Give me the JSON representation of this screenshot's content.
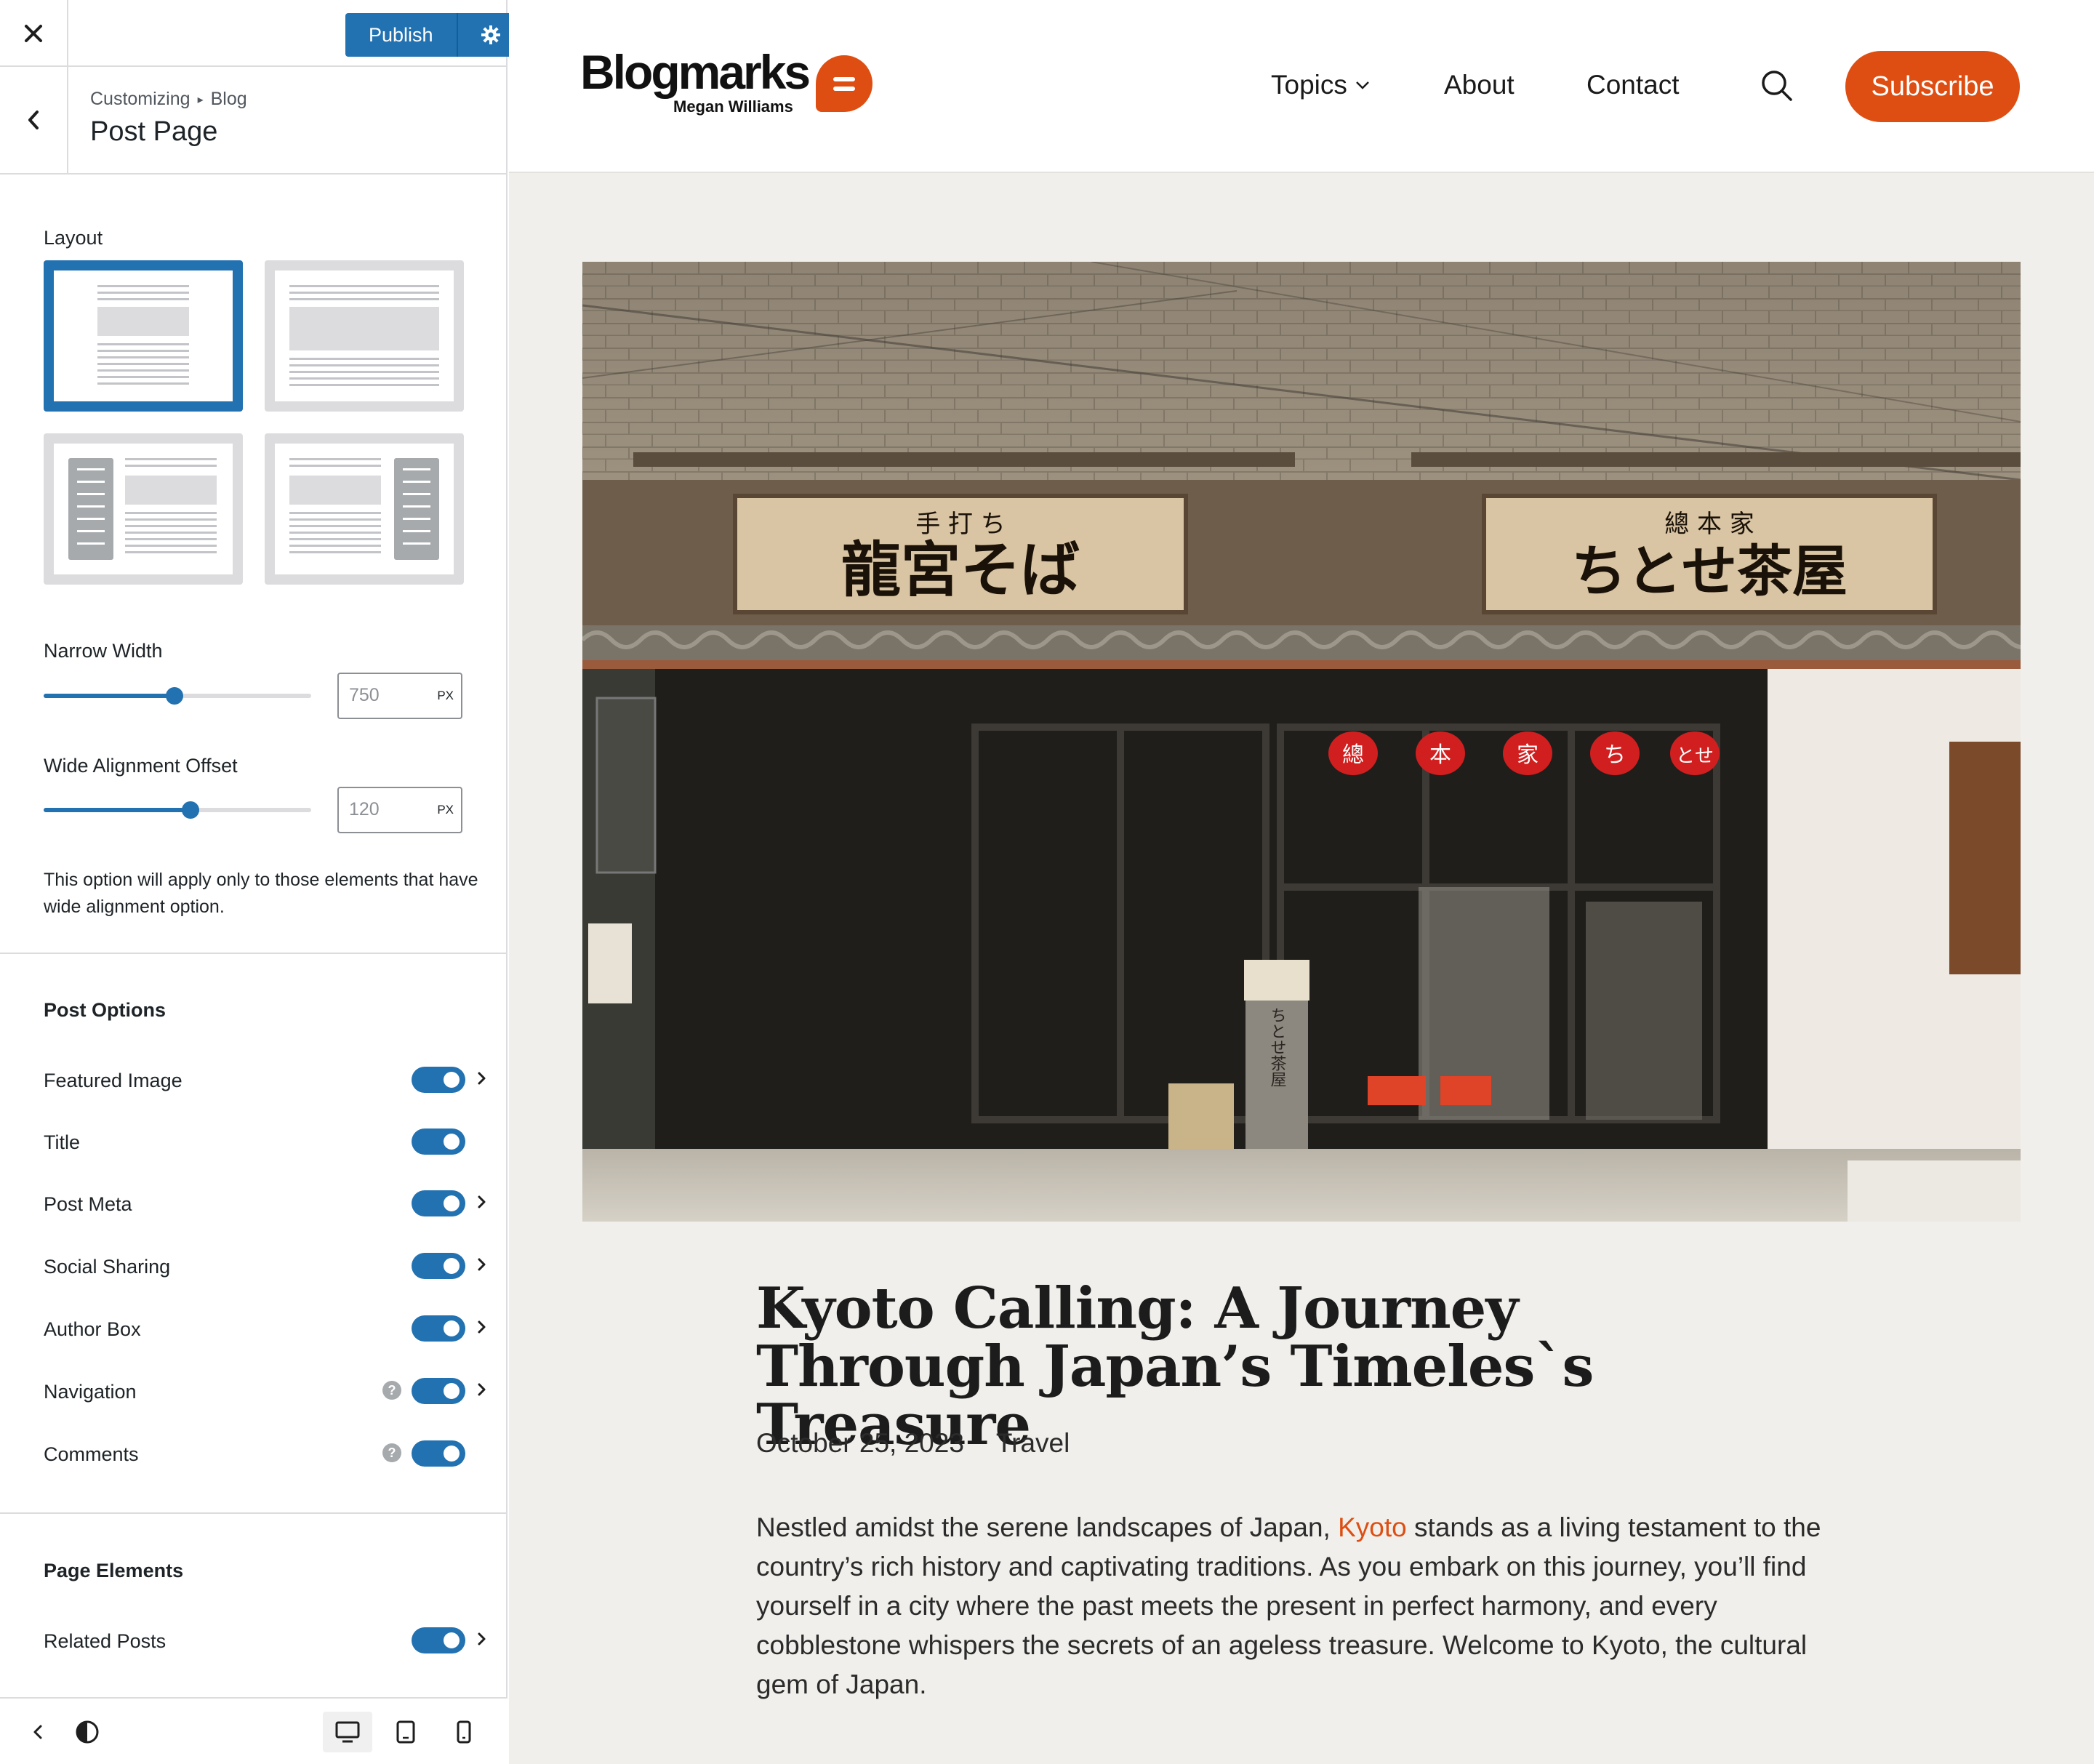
{
  "customizer": {
    "publish_label": "Publish",
    "breadcrumb": [
      "Customizing",
      "Blog"
    ],
    "panel_title": "Post Page",
    "layout": {
      "label": "Layout",
      "options": [
        "narrow-centered",
        "wide",
        "left-sidebar",
        "right-sidebar"
      ],
      "selected": "narrow-centered"
    },
    "narrow_width": {
      "label": "Narrow Width",
      "value": "750",
      "unit": "PX",
      "fraction": 0.49
    },
    "wide_offset": {
      "label": "Wide Alignment Offset",
      "value": "120",
      "unit": "PX",
      "fraction": 0.55
    },
    "wide_offset_help": "This option will apply only to those elements that have wide alignment option.",
    "post_options": {
      "heading": "Post Options",
      "items": [
        {
          "label": "Featured Image",
          "enabled": true
        },
        {
          "label": "Title",
          "enabled": true
        },
        {
          "label": "Post Meta",
          "enabled": true
        },
        {
          "label": "Social Sharing",
          "enabled": true
        },
        {
          "label": "Author Box",
          "enabled": true
        },
        {
          "label": "Navigation",
          "enabled": true
        },
        {
          "label": "Comments",
          "enabled": true
        }
      ]
    },
    "page_elements": {
      "heading": "Page Elements",
      "items": [
        {
          "label": "Related Posts",
          "enabled": true
        }
      ]
    },
    "help_glyph": "?"
  },
  "site": {
    "logo": "Blogmarks",
    "logo_subtitle": "Megan Williams",
    "nav": [
      "Topics",
      "About",
      "Contact"
    ],
    "subscribe_label": "Subscribe",
    "accent_color": "#de4e12",
    "post": {
      "title": "Kyoto Calling: A Journey Through Japan’s Timeles`s Treasure",
      "date": "October 25, 2023",
      "category": "Travel",
      "body_before_link": "Nestled amidst the serene landscapes of Japan, ",
      "body_link": "Kyoto",
      "body_after_link": " stands as a living testament to the country’s rich history and captivating traditions. As you embark on this journey, you’ll find yourself in a city where the past meets the present in perfect harmony, and every cobblestone whispers the secrets of an ageless treasure. Welcome to Kyoto, the cultural gem of Japan."
    },
    "hero_signs": {
      "left_small": "手 打 ち",
      "left_main": "龍宮そば",
      "right_small": "總 本 家",
      "right_main": "ちとせ茶屋",
      "lantern_chars": [
        "總",
        "本",
        "家",
        "ち",
        "とせ"
      ],
      "pillar_text": "ちとせ茶屋"
    }
  }
}
